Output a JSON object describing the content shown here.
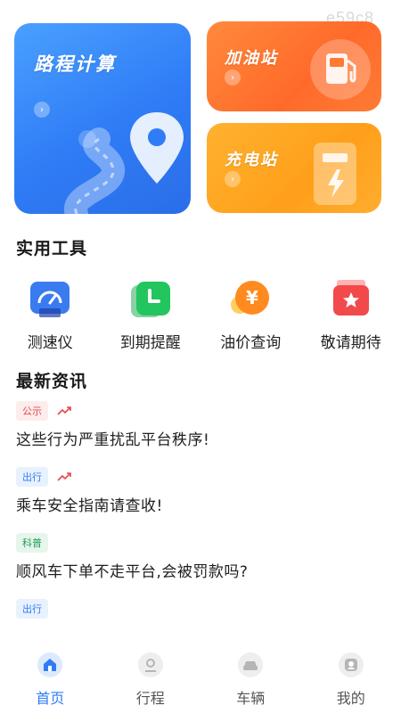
{
  "watermark": "e59c8",
  "cards": {
    "route": {
      "title": "路程计算"
    },
    "gas": {
      "title": "加油站"
    },
    "ev": {
      "title": "充电站"
    }
  },
  "tools_section": {
    "title": "实用工具",
    "items": [
      {
        "label": "测速仪",
        "icon": "speedometer-icon",
        "color": "#3b7bf0"
      },
      {
        "label": "到期提醒",
        "icon": "clock-icon",
        "color": "#22c55e"
      },
      {
        "label": "油价查询",
        "icon": "yen-coin-icon",
        "color": "#ff8a1f"
      },
      {
        "label": "敬请期待",
        "icon": "star-box-icon",
        "color": "#f24a4a"
      }
    ]
  },
  "news_section": {
    "title": "最新资讯",
    "items": [
      {
        "tag": "公示",
        "tag_color": "#e5484d",
        "tag_bg": "#fdecec",
        "trending": true,
        "text": "这些行为严重扰乱平台秩序!"
      },
      {
        "tag": "出行",
        "tag_color": "#2f7cf6",
        "tag_bg": "#e8f1fe",
        "trending": true,
        "text": "乘车安全指南请查收!"
      },
      {
        "tag": "科普",
        "tag_color": "#1f9d55",
        "tag_bg": "#e6f6ec",
        "trending": false,
        "text": "顺风车下单不走平台,会被罚款吗?"
      },
      {
        "tag": "出行",
        "tag_color": "#2f7cf6",
        "tag_bg": "#e8f1fe",
        "trending": false,
        "text": ""
      }
    ]
  },
  "tabbar": {
    "active_color": "#2f7cf6",
    "items": [
      {
        "label": "首页",
        "icon": "home-icon"
      },
      {
        "label": "行程",
        "icon": "trip-icon"
      },
      {
        "label": "车辆",
        "icon": "car-icon"
      },
      {
        "label": "我的",
        "icon": "profile-icon"
      }
    ]
  }
}
